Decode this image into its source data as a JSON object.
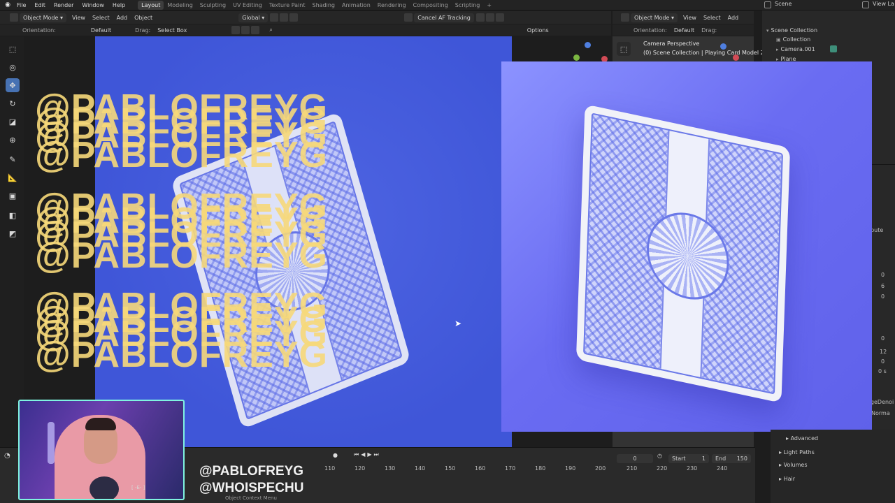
{
  "menubar": {
    "menus": [
      "File",
      "Edit",
      "Render",
      "Window",
      "Help"
    ],
    "workspaces": [
      "Layout",
      "Modeling",
      "Sculpting",
      "UV Editing",
      "Texture Paint",
      "Shading",
      "Animation",
      "Rendering",
      "Compositing",
      "Scripting"
    ],
    "active_workspace": "Layout",
    "scene": "Scene",
    "view_layer": "View La"
  },
  "viewport_header": {
    "mode": "Object Mode",
    "menus": [
      "View",
      "Select",
      "Add",
      "Object"
    ],
    "transform": "Global",
    "cancel_label": "Cancel AF Tracking"
  },
  "viewport_subheader": {
    "orientation_label": "Orientation:",
    "orientation_value": "Default",
    "drag_label": "Drag:",
    "drag_value": "Select Box",
    "options_label": "Options"
  },
  "right_viewport": {
    "mode": "Object Mode",
    "menus": [
      "View",
      "Select",
      "Add"
    ],
    "orientation_label": "Orientation:",
    "orientation_value": "Default",
    "drag_label": "Drag:",
    "camera_title": "Camera Perspective",
    "camera_sub": "(0) Scene Collection | Playing Card Model 2.0"
  },
  "outliner": {
    "items": [
      "Scene Collection",
      "Collection",
      "Camera.001",
      "Plane"
    ]
  },
  "timeline": {
    "frames": [
      "110",
      "120",
      "130",
      "140",
      "150",
      "160",
      "170",
      "180",
      "190",
      "200",
      "210",
      "220",
      "230",
      "240"
    ],
    "current_frame": "0",
    "start_label": "Start",
    "start_value": "1",
    "end_label": "End",
    "end_value": "150",
    "status": "Object Context Menu"
  },
  "properties": {
    "rows": [
      "Advanced",
      "Light Paths",
      "Volumes",
      "Hair"
    ],
    "partial": [
      "d",
      "npute",
      "0",
      "6",
      "0",
      "0",
      "12",
      "0",
      "0 s",
      "ageDenoi",
      "Norma"
    ]
  },
  "overlay": {
    "watermark": "@PABLOFREYG",
    "handle_1": "@PABLOFREYG",
    "handle_2": "@WHOISPECHU",
    "cam_caption": "[ -E- ]"
  },
  "colors": {
    "viewport_blue": "#3f56d8",
    "render_blue": "#6a6cf2",
    "watermark_yellow": "#f7d97a",
    "webcam_border": "#7ff3e0",
    "accent": "#4772b3"
  }
}
